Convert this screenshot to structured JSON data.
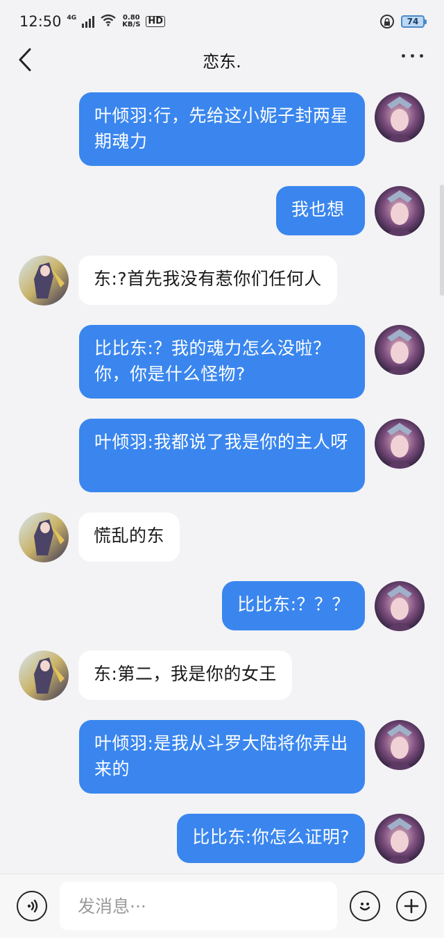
{
  "status_bar": {
    "time": "12:50",
    "network": "4G",
    "speed_value": "0.80",
    "speed_unit": "KB/S",
    "hd": "HD",
    "battery": "74"
  },
  "header": {
    "title": "恋东."
  },
  "messages": [
    {
      "side": "out",
      "text": "叶倾羽:行，先给这小妮子封两星期魂力"
    },
    {
      "side": "out",
      "text": "我也想"
    },
    {
      "side": "in",
      "text": "东:?首先我没有惹你们任何人"
    },
    {
      "side": "out",
      "text": "比比东:？我的魂力怎么没啦？你，你是什么怪物?"
    },
    {
      "side": "out",
      "text": "叶倾羽:我都说了我是你的主人呀"
    },
    {
      "side": "in",
      "text": "慌乱的东"
    },
    {
      "side": "out",
      "text": "比比东:？？？"
    },
    {
      "side": "in",
      "text": "东:第二，我是你的女王"
    },
    {
      "side": "out",
      "text": "叶倾羽:是我从斗罗大陆将你弄出来的"
    },
    {
      "side": "out",
      "text": "比比东:你怎么证明?"
    }
  ],
  "input_bar": {
    "placeholder": "发消息···"
  },
  "icons": {
    "voice": "voice-icon",
    "emoji": "emoji-icon",
    "plus": "plus-icon",
    "back": "back-arrow-icon",
    "more": "more-icon"
  },
  "colors": {
    "outgoing_bubble": "#3a86ee",
    "incoming_bubble": "#ffffff",
    "background": "#f3f3f5"
  }
}
